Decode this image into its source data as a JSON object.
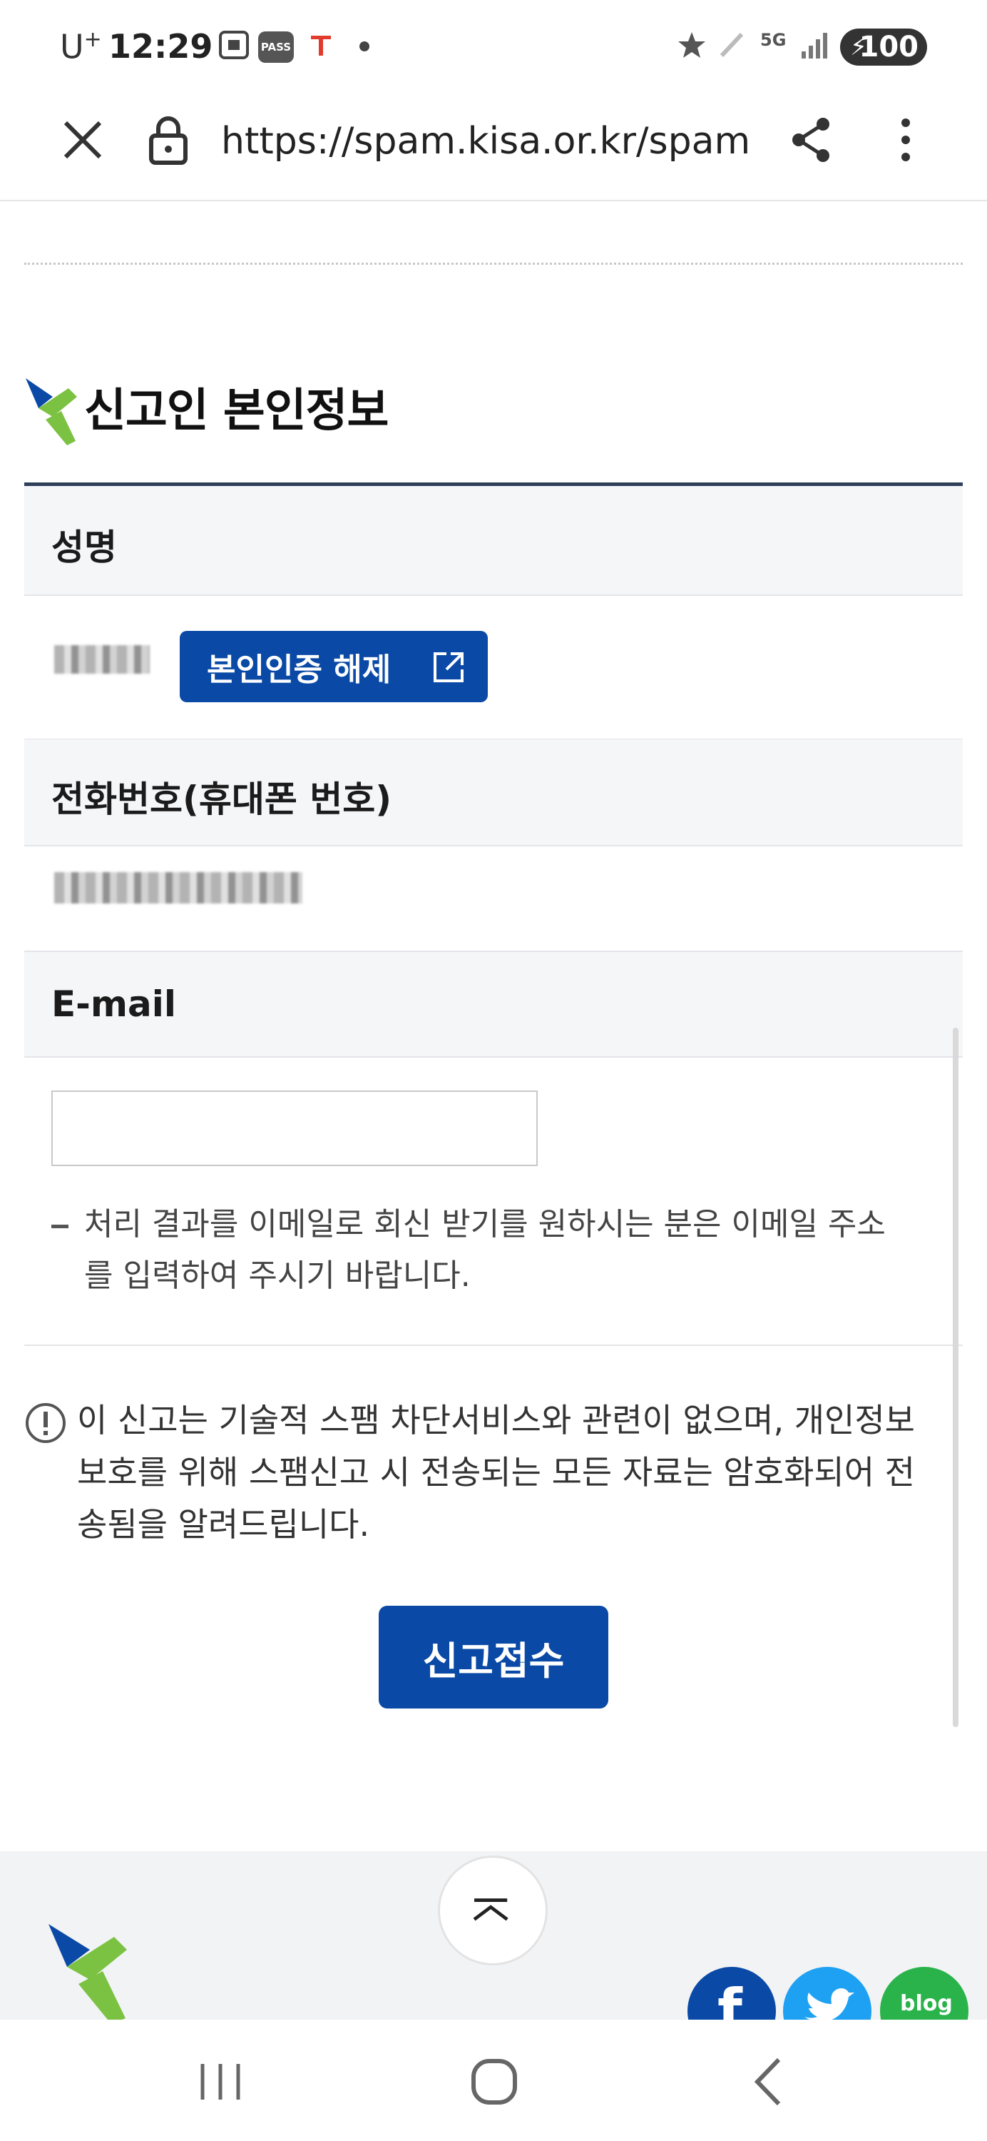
{
  "status_bar": {
    "carrier": "U",
    "carrier_sup": "+",
    "time": "12:29",
    "battery": "100",
    "network": "5G",
    "pass_badge": "PASS"
  },
  "browser": {
    "url": "https://spam.kisa.or.kr/spam/"
  },
  "section": {
    "title": "신고인 본인정보"
  },
  "form": {
    "name_label": "성명",
    "verify_button": "본인인증 해제",
    "phone_label": "전화번호(휴대폰 번호)",
    "email_label": "E-mail",
    "email_value": "",
    "email_note": "처리 결과를 이메일로 회신 받기를 원하시는 분은 이메일 주소를 입력하여 주시기 바랍니다."
  },
  "notice": {
    "text": "이 신고는 기술적 스팸 차단서비스와 관련이 없으며, 개인정보보호를 위해 스팸신고 시 전송되는 모든 자료는 암호화되어 전송됨을 알려드립니다."
  },
  "submit_button": "신고접수",
  "footer": {
    "social": [
      {
        "name": "facebook",
        "label": "f",
        "color": "#0a4aa6"
      },
      {
        "name": "twitter",
        "label": "",
        "color": "#1ea1f2"
      },
      {
        "name": "blog",
        "label": "blog",
        "color": "#2ab34a"
      }
    ]
  },
  "colors": {
    "primary": "#0a4aa6",
    "header_row": "#f5f6f8",
    "table_border_top": "#2f3f5a",
    "logo_blue": "#0a4aa6",
    "logo_green": "#7cc242"
  }
}
